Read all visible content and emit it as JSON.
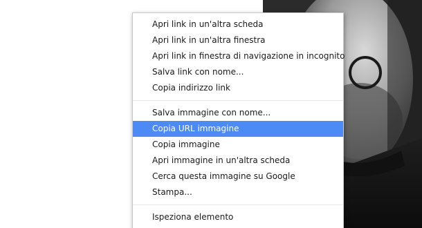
{
  "context_menu": {
    "groups": [
      {
        "items": [
          {
            "label": "Apri link in un'altra scheda"
          },
          {
            "label": "Apri link in un'altra finestra"
          },
          {
            "label": "Apri link in finestra di navigazione in incognito"
          },
          {
            "label": "Salva link con nome..."
          },
          {
            "label": "Copia indirizzo link"
          }
        ]
      },
      {
        "items": [
          {
            "label": "Salva immagine con nome..."
          },
          {
            "label": "Copia URL immagine",
            "highlighted": true
          },
          {
            "label": "Copia immagine"
          },
          {
            "label": "Apri immagine in un'altra scheda"
          },
          {
            "label": "Cerca questa immagine su Google"
          },
          {
            "label": "Stampa..."
          }
        ]
      },
      {
        "items": [
          {
            "label": "Ispeziona elemento"
          }
        ]
      }
    ]
  },
  "colors": {
    "highlight": "#4c8bf5",
    "menu_border": "#c9c9c9",
    "separator": "#e6e6e6"
  }
}
